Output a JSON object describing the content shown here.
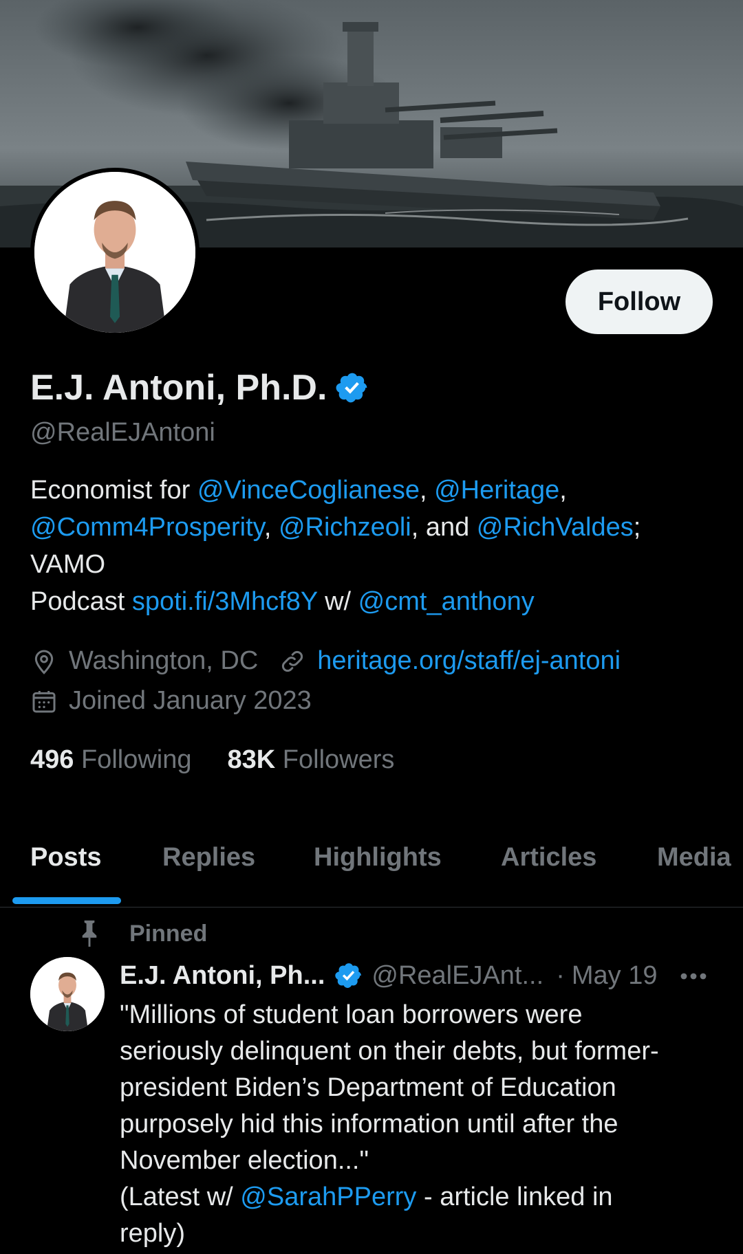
{
  "profile": {
    "name": "E.J. Antoni, Ph.D.",
    "handle": "@RealEJAntoni",
    "follow_label": "Follow",
    "bio": {
      "line1_prefix": "Economist for ",
      "mention1": "@VinceCoglianese",
      "sep1": ", ",
      "mention2": "@Heritage",
      "sep2": ",",
      "mention3": "@Comm4Prosperity",
      "sep3": ", ",
      "mention4": "@Richzeoli",
      "sep4": ", and ",
      "mention5": "@RichValdes",
      "sep5": ";",
      "line3": "VAMO",
      "line4_prefix": "Podcast ",
      "podcast_link": "spoti.fi/3Mhcf8Y",
      "line4_mid": " w/ ",
      "mention6": "@cmt_anthony"
    },
    "location": "Washington, DC",
    "website": "heritage.org/staff/ej-antoni",
    "joined": "Joined January 2023",
    "following_count": "496",
    "following_label": "Following",
    "followers_count": "83K",
    "followers_label": "Followers"
  },
  "tabs": [
    "Posts",
    "Replies",
    "Highlights",
    "Articles",
    "Media"
  ],
  "active_tab": "Posts",
  "pinned_post": {
    "pinned_label": "Pinned",
    "author_name": "E.J. Antoni, Ph...",
    "author_handle": "@RealEJAnt...",
    "dot": "·",
    "date": "May 19",
    "text_lines": [
      "\"Millions of student loan borrowers were",
      "seriously delinquent on their debts, but former-",
      "president Biden’s Department of Education",
      "purposely hid this information until after the",
      "November election...\""
    ],
    "last_prefix": "(Latest w/ ",
    "last_mention": "@SarahPPerry",
    "last_suffix": " - article linked in",
    "final_line": "reply)"
  },
  "colors": {
    "background": "#000000",
    "text": "#e7e9ea",
    "muted": "#71767b",
    "accent": "#1d9bf0",
    "follow_bg": "#eff3f4"
  },
  "icons": {
    "verified": "verified-badge-icon",
    "location": "location-pin-icon",
    "link": "link-icon",
    "calendar": "calendar-icon",
    "pin": "pin-icon",
    "more": "more-dots-icon"
  }
}
